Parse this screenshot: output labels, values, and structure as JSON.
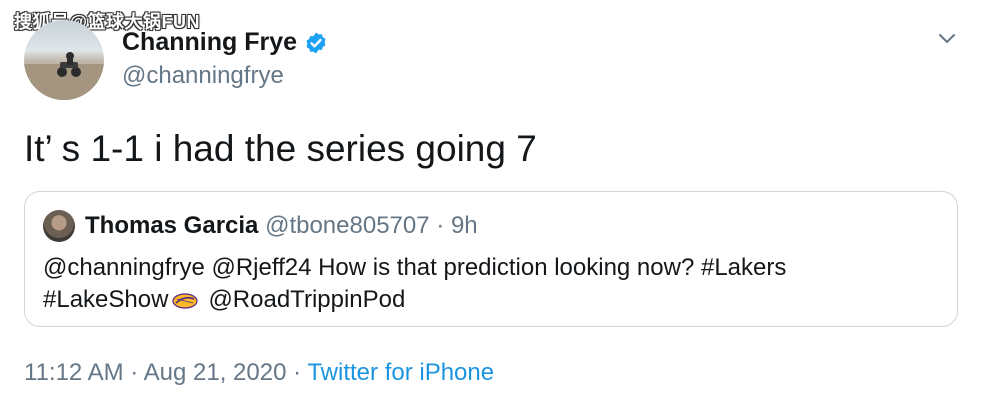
{
  "watermark": "搜狐号@篮球大锅FUN",
  "author": {
    "display_name": "Channing Frye",
    "handle": "@channingfrye",
    "verified": true,
    "avatar_icon": "profile-photo"
  },
  "tweet": {
    "text": "It’ s 1-1 i had the series going 7"
  },
  "quote": {
    "display_name": "Thomas Garcia",
    "handle": "@tbone805707",
    "separator": "·",
    "time": "9h",
    "line1": "@channingfrye @Rjeff24 How is that prediction looking now? #Lakers",
    "line2_part1": "#LakeShow",
    "line2_part2": "@RoadTrippinPod",
    "emoji_icon": "lakers-logo-icon"
  },
  "meta": {
    "time": "11:12 AM",
    "separator1": "·",
    "date": "Aug 21, 2020",
    "separator2": "·",
    "source": "Twitter for iPhone"
  },
  "colors": {
    "text": "#14171a",
    "secondary": "#657786",
    "link": "#1b95e0",
    "verified": "#1da1f2",
    "border": "#ccd6dd"
  }
}
